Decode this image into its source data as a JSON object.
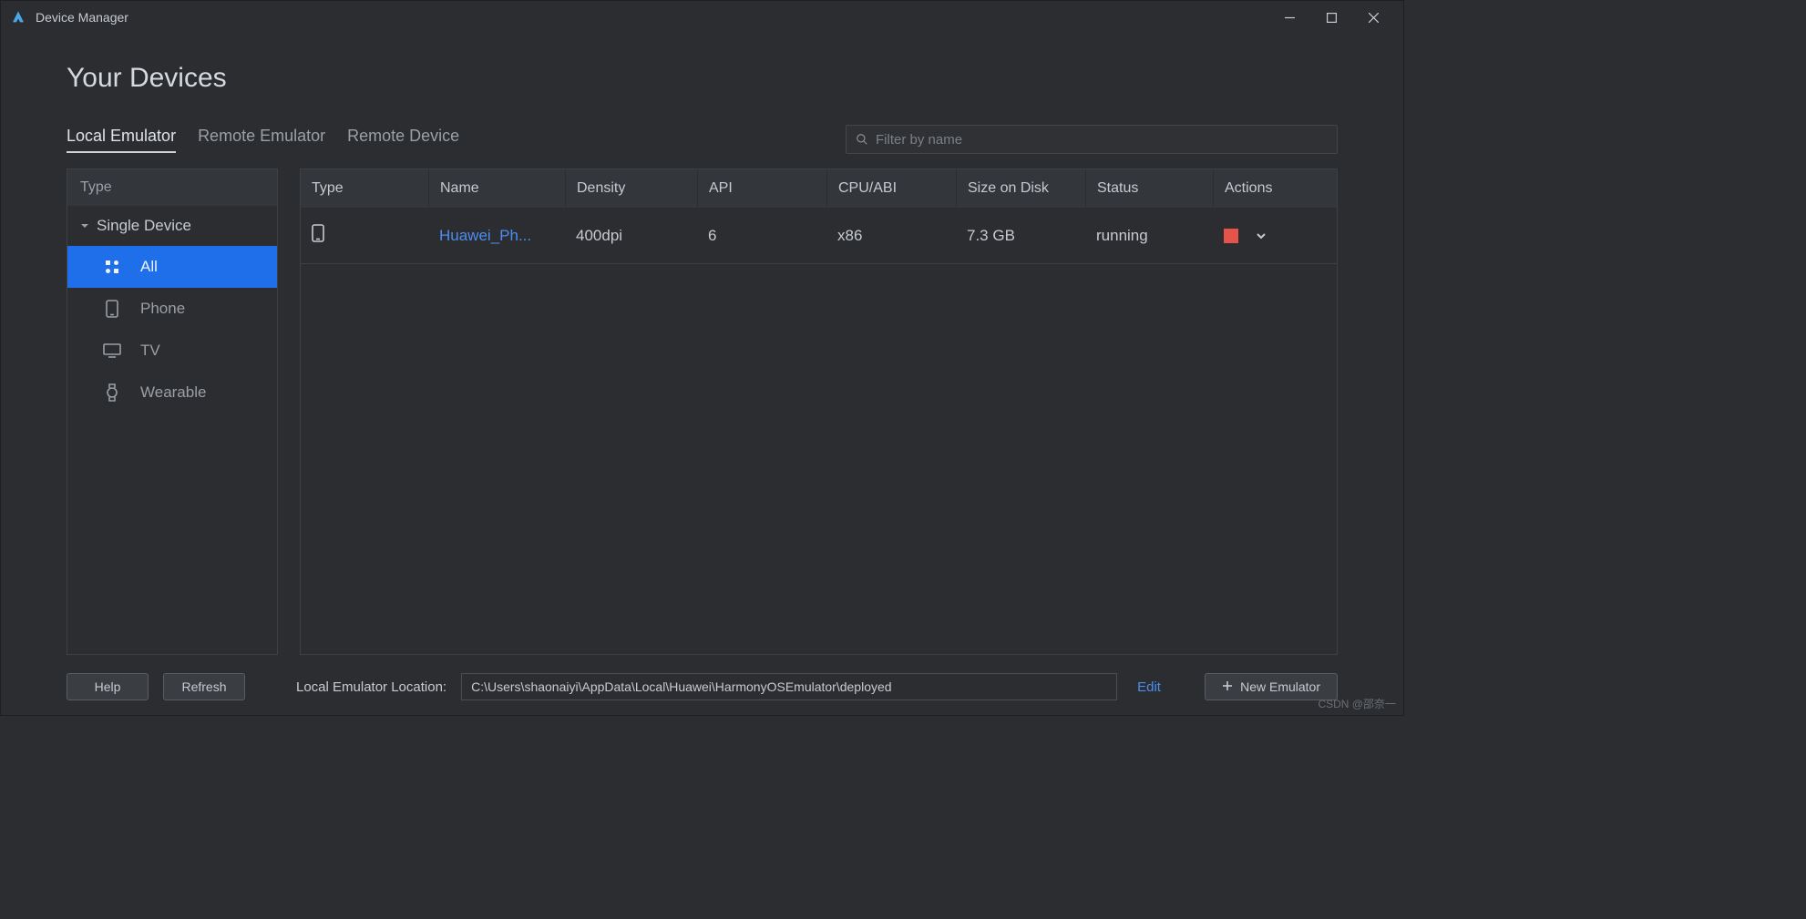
{
  "window": {
    "title": "Device Manager"
  },
  "page": {
    "heading": "Your Devices"
  },
  "tabs": {
    "local": "Local Emulator",
    "remote_emu": "Remote Emulator",
    "remote_dev": "Remote Device"
  },
  "search": {
    "placeholder": "Filter by name"
  },
  "sidebar": {
    "header": "Type",
    "group": "Single Device",
    "items": {
      "all": "All",
      "phone": "Phone",
      "tv": "TV",
      "wearable": "Wearable"
    }
  },
  "table": {
    "headers": {
      "type": "Type",
      "name": "Name",
      "density": "Density",
      "api": "API",
      "cpu": "CPU/ABI",
      "size": "Size on Disk",
      "status": "Status",
      "actions": "Actions"
    },
    "rows": [
      {
        "name": "Huawei_Ph...",
        "density": "400dpi",
        "api": "6",
        "cpu": "x86",
        "size": "7.3 GB",
        "status": "running"
      }
    ]
  },
  "footer": {
    "help": "Help",
    "refresh": "Refresh",
    "loc_label": "Local Emulator Location:",
    "loc_value": "C:\\Users\\shaonaiyi\\AppData\\Local\\Huawei\\HarmonyOSEmulator\\deployed",
    "edit": "Edit",
    "new_emulator": "New Emulator"
  },
  "watermark": "CSDN @邵奈一"
}
